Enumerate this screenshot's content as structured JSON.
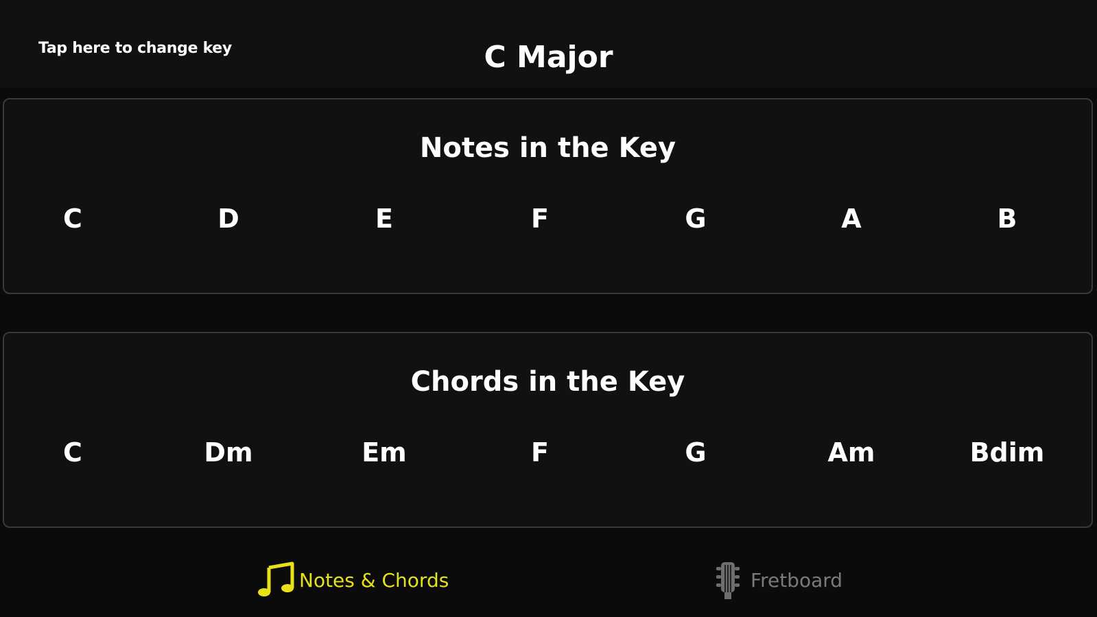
{
  "header": {
    "change_key_label": "Tap here to change key",
    "key_title": "C Major"
  },
  "notes_panel": {
    "title": "Notes in the Key",
    "items": [
      "C",
      "D",
      "E",
      "F",
      "G",
      "A",
      "B"
    ]
  },
  "chords_panel": {
    "title": "Chords in the Key",
    "items": [
      "C",
      "Dm",
      "Em",
      "F",
      "G",
      "Am",
      "Bdim"
    ]
  },
  "tabbar": {
    "tabs": [
      {
        "label": "Notes & Chords",
        "icon": "music-note-icon",
        "active": true
      },
      {
        "label": "Fretboard",
        "icon": "guitar-headstock-icon",
        "active": false
      }
    ]
  },
  "colors": {
    "accent": "#e8e117",
    "inactive": "#7a7a7a",
    "background": "#0b0b0b",
    "panel": "#111111"
  }
}
